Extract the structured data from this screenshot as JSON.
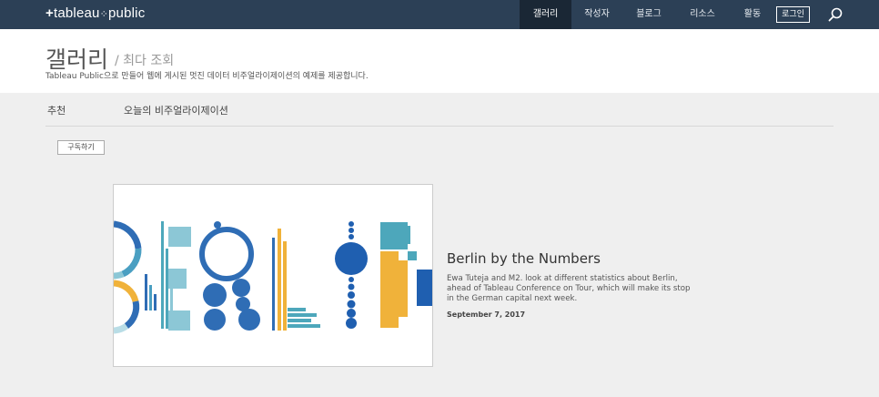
{
  "nav": {
    "logo": "+tableau+public",
    "items": [
      "갤러리",
      "작성자",
      "블로그",
      "리소스",
      "활동"
    ],
    "login": "로그인",
    "search_icon": "search-icon"
  },
  "header": {
    "title": "갤러리",
    "subtitle": "/ 최다 조회",
    "description": "Tableau Public으로 만들어 웹에 게시된 멋진 데이터 비주얼라이제이션의 예제를 제공합니다."
  },
  "tabs": {
    "recommended": "추천",
    "today": "오늘의 비주얼라이제이션"
  },
  "subscribe": "구독하기",
  "card": {
    "title": "Berlin by the Numbers",
    "description": "Ewa Tuteja and M2. look at different statistics about Berlin, ahead of Tableau Conference on Tour, which will make its stop in the German capital next week.",
    "date": "September 7, 2017"
  }
}
